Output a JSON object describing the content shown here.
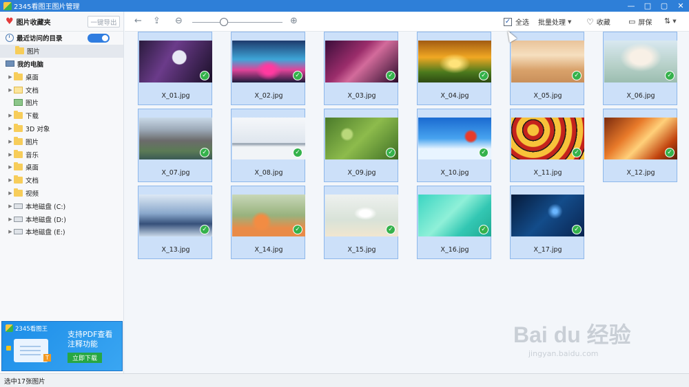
{
  "window": {
    "title": "2345看图王图片管理",
    "controls": [
      "—",
      "□",
      "▢",
      "✕"
    ]
  },
  "sidebar": {
    "favorites_label": "图片收藏夹",
    "export_label": "一键导出",
    "recent_label": "最近访问的目录",
    "recent_toggle_on": true,
    "recent_item": "图片",
    "computer_label": "我的电脑",
    "items": [
      {
        "label": "桌面",
        "icon": "folder-icon"
      },
      {
        "label": "文档",
        "icon": "doc-icon"
      },
      {
        "label": "图片",
        "icon": "pic-icon"
      },
      {
        "label": "下载",
        "icon": "folder-icon"
      },
      {
        "label": "3D 对象",
        "icon": "folder-icon"
      },
      {
        "label": "图片",
        "icon": "folder-icon"
      },
      {
        "label": "音乐",
        "icon": "folder-icon"
      },
      {
        "label": "桌面",
        "icon": "folder-icon"
      },
      {
        "label": "文档",
        "icon": "folder-icon"
      },
      {
        "label": "视频",
        "icon": "folder-icon"
      },
      {
        "label": "本地磁盘 (C:)",
        "icon": "drive-icon"
      },
      {
        "label": "本地磁盘 (D:)",
        "icon": "drive-icon"
      },
      {
        "label": "本地磁盘 (E:)",
        "icon": "drive-icon"
      }
    ]
  },
  "ad": {
    "app_name": "2345看图王",
    "line1": "支持PDF查看",
    "line2": "注释功能",
    "button": "立即下载",
    "badge": "T"
  },
  "toolbar": {
    "select_all_label": "全选",
    "select_all_checked": true,
    "batch_label": "批量处理",
    "favorite_label": "收藏",
    "screen_label": "屏保"
  },
  "status": {
    "text": "选中17张图片"
  },
  "images": [
    {
      "name": "X_01.jpg",
      "checked": true
    },
    {
      "name": "X_02.jpg",
      "checked": true
    },
    {
      "name": "X_03.jpg",
      "checked": true
    },
    {
      "name": "X_04.jpg",
      "checked": true
    },
    {
      "name": "X_05.jpg",
      "checked": true
    },
    {
      "name": "X_06.jpg",
      "checked": true
    },
    {
      "name": "X_07.jpg",
      "checked": true
    },
    {
      "name": "X_08.jpg",
      "checked": true
    },
    {
      "name": "X_09.jpg",
      "checked": true
    },
    {
      "name": "X_10.jpg",
      "checked": true
    },
    {
      "name": "X_11.jpg",
      "checked": true
    },
    {
      "name": "X_12.jpg",
      "checked": true
    },
    {
      "name": "X_13.jpg",
      "checked": true
    },
    {
      "name": "X_14.jpg",
      "checked": true
    },
    {
      "name": "X_15.jpg",
      "checked": true
    },
    {
      "name": "X_16.jpg",
      "checked": true
    },
    {
      "name": "X_17.jpg",
      "checked": true
    }
  ],
  "watermark": {
    "brand": "Bai du 经验",
    "url": "jingyan.baidu.com"
  }
}
